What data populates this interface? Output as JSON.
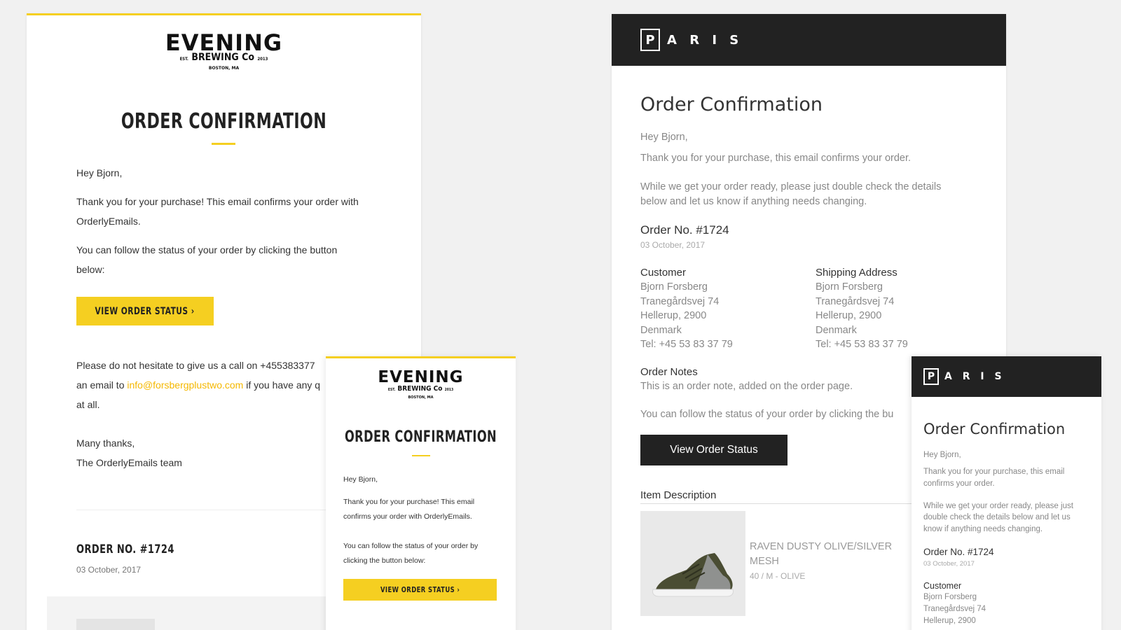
{
  "evening_desktop": {
    "brand": {
      "name": "EVENING",
      "sub": "BREWING Co",
      "est": "EST.",
      "year": "2013",
      "location": "BOSTON, MA"
    },
    "title": "ORDER CONFIRMATION",
    "greeting": "Hey Bjorn,",
    "body_line1": "Thank you for your purchase! This email confirms your order with",
    "body_line2": "OrderlyEmails.",
    "follow_line1": "You can follow the status of your order by clicking the button",
    "follow_line2": "below:",
    "button_label": "VIEW ORDER STATUS ›",
    "contact_line1": "Please do not hesitate to give us a call on +455383377",
    "contact_prefix": "an email to ",
    "contact_email": "info@forsbergplustwo.com",
    "contact_suffix": " if you have any q",
    "contact_line3": "at all.",
    "signoff": "Many thanks,",
    "team": "The OrderlyEmails team",
    "order_no": "ORDER NO. #1724",
    "order_date": "03 October, 2017"
  },
  "evening_mobile": {
    "brand": {
      "name": "EVENING",
      "sub": "BREWING Co",
      "est": "EST.",
      "year": "2013",
      "location": "BOSTON, MA"
    },
    "title": "ORDER CONFIRMATION",
    "greeting": "Hey Bjorn,",
    "body_line1": "Thank you for your purchase! This email",
    "body_line2": "confirms your order with OrderlyEmails.",
    "follow_line1": "You can follow the status of your order by",
    "follow_line2": "clicking the button below:",
    "button_label": "VIEW ORDER STATUS ›"
  },
  "paris_desktop": {
    "logo_letter": "P",
    "logo_rest": "A R I S",
    "title": "Order Confirmation",
    "greeting": "Hey Bjorn,",
    "thanks": "Thank you for your purchase, this email confirms your order.",
    "ready_line1": "While we get your order ready, please just double check the details",
    "ready_line2": "below and let us know if anything needs changing.",
    "order_no": "Order No. #1724",
    "order_date": "03 October, 2017",
    "customer_heading": "Customer",
    "customer_lines": [
      "Bjorn Forsberg",
      "Tranegårdsvej 74",
      "Hellerup, 2900",
      "Denmark",
      "Tel: +45 53 83 37 79"
    ],
    "shipping_heading": "Shipping Address",
    "shipping_lines": [
      "Bjorn Forsberg",
      "Tranegårdsvej 74",
      "Hellerup, 2900",
      "Denmark",
      "Tel: +45 53 83 37 79"
    ],
    "notes_heading": "Order Notes",
    "notes_text": "This is an order note, added on the order page.",
    "follow_text": "You can follow the status of your order by clicking the bu",
    "button_label": "View Order Status",
    "item_heading": "Item Description",
    "item_name_line1": "RAVEN DUSTY OLIVE/SILVER",
    "item_name_line2": "MESH",
    "item_variant": "40 / M - OLIVE"
  },
  "paris_mobile": {
    "logo_letter": "P",
    "logo_rest": "A R I S",
    "title": "Order Confirmation",
    "greeting": "Hey Bjorn,",
    "thanks_line1": "Thank you for your purchase, this email",
    "thanks_line2": "confirms your order.",
    "ready_line1": "While we get your order ready, please just",
    "ready_line2": "double check the details below and let us",
    "ready_line3": "know if anything needs changing.",
    "order_no": "Order No. #1724",
    "order_date": "03 October, 2017",
    "customer_heading": "Customer",
    "customer_lines": [
      "Bjorn Forsberg",
      "Tranegårdsvej 74",
      "Hellerup, 2900"
    ]
  },
  "colors": {
    "accent_yellow": "#f5cf21",
    "paris_dark": "#222222",
    "background": "#f1f1f1"
  }
}
